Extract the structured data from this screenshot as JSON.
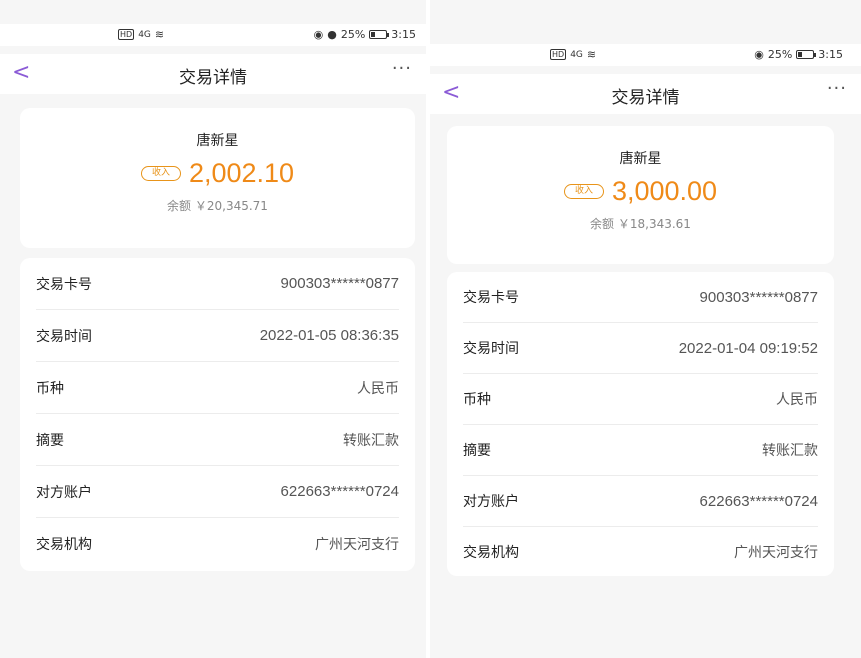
{
  "screens": [
    {
      "status": {
        "hd": "HD",
        "signal": "4G",
        "battery_pct_label": "25%",
        "battery_level": 0.25,
        "time": "3:15"
      },
      "nav": {
        "back": "<",
        "title": "交易详情",
        "more": "···"
      },
      "summary": {
        "name": "唐新星",
        "badge": "收入",
        "amount": "2,002.10",
        "balance": "余额 ￥20,345.71"
      },
      "details": [
        {
          "label": "交易卡号",
          "value": "900303******0877"
        },
        {
          "label": "交易时间",
          "value": "2022-01-05 08:36:35"
        },
        {
          "label": "币种",
          "value": "人民币"
        },
        {
          "label": "摘要",
          "value": "转账汇款"
        },
        {
          "label": "对方账户",
          "value": "622663******0724"
        },
        {
          "label": "交易机构",
          "value": "广州天河支行"
        }
      ]
    },
    {
      "status": {
        "hd": "HD",
        "signal": "4G",
        "battery_pct_label": "25%",
        "battery_level": 0.25,
        "time": "3:15"
      },
      "nav": {
        "back": "<",
        "title": "交易详情",
        "more": "···"
      },
      "summary": {
        "name": "唐新星",
        "badge": "收入",
        "amount": "3,000.00",
        "balance": "余额 ￥18,343.61"
      },
      "details": [
        {
          "label": "交易卡号",
          "value": "900303******0877"
        },
        {
          "label": "交易时间",
          "value": "2022-01-04 09:19:52"
        },
        {
          "label": "币种",
          "value": "人民币"
        },
        {
          "label": "摘要",
          "value": "转账汇款"
        },
        {
          "label": "对方账户",
          "value": "622663******0724"
        },
        {
          "label": "交易机构",
          "value": "广州天河支行"
        }
      ]
    }
  ],
  "colors": {
    "accent": "#8b5bd6",
    "amount": "#ef8a18",
    "background": "#f6f6f6"
  }
}
